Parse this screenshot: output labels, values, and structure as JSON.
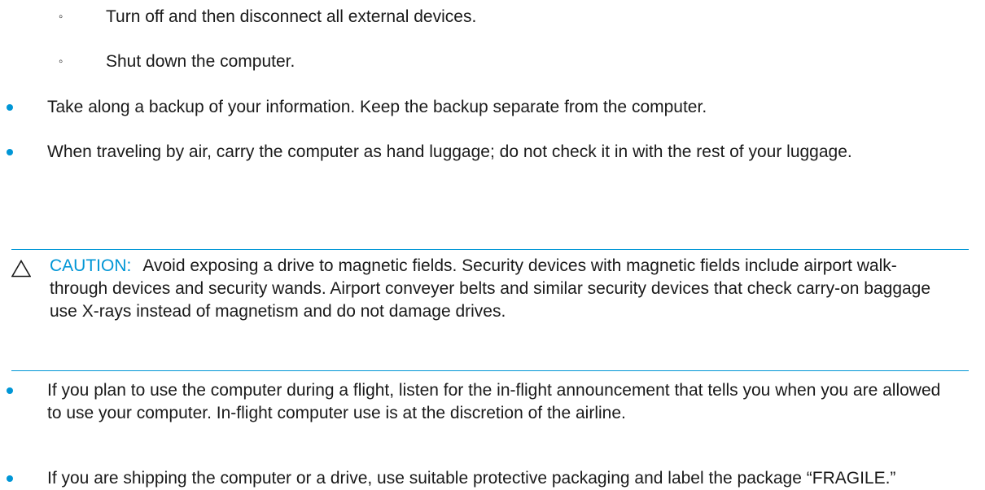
{
  "sub_items": [
    {
      "marker": "◦",
      "text": "Turn off and then disconnect all external devices."
    },
    {
      "marker": "◦",
      "text": "Shut down the computer."
    }
  ],
  "items": [
    {
      "text": "Take along a backup of your information. Keep the backup separate from the computer."
    },
    {
      "text": "When traveling by air, carry the computer as hand luggage; do not check it in with the rest of your luggage."
    },
    {
      "text": "If you plan to use the computer during a flight, listen for the in-flight announcement that tells you when you are allowed to use your computer. In-flight computer use is at the discretion of the airline."
    },
    {
      "text": "If you are shipping the computer or a drive, use suitable protective packaging and label the package “FRAGILE.”"
    }
  ],
  "caution": {
    "label": "CAUTION:",
    "text": "Avoid exposing a drive to magnetic fields. Security devices with magnetic fields include airport walk-through devices and security wands. Airport conveyer belts and similar security devices that check carry-on baggage use X-rays instead of magnetism and do not damage drives.",
    "icon": "warning-triangle-icon"
  },
  "colors": {
    "accent": "#0096d6",
    "text": "#1a1a1a"
  }
}
